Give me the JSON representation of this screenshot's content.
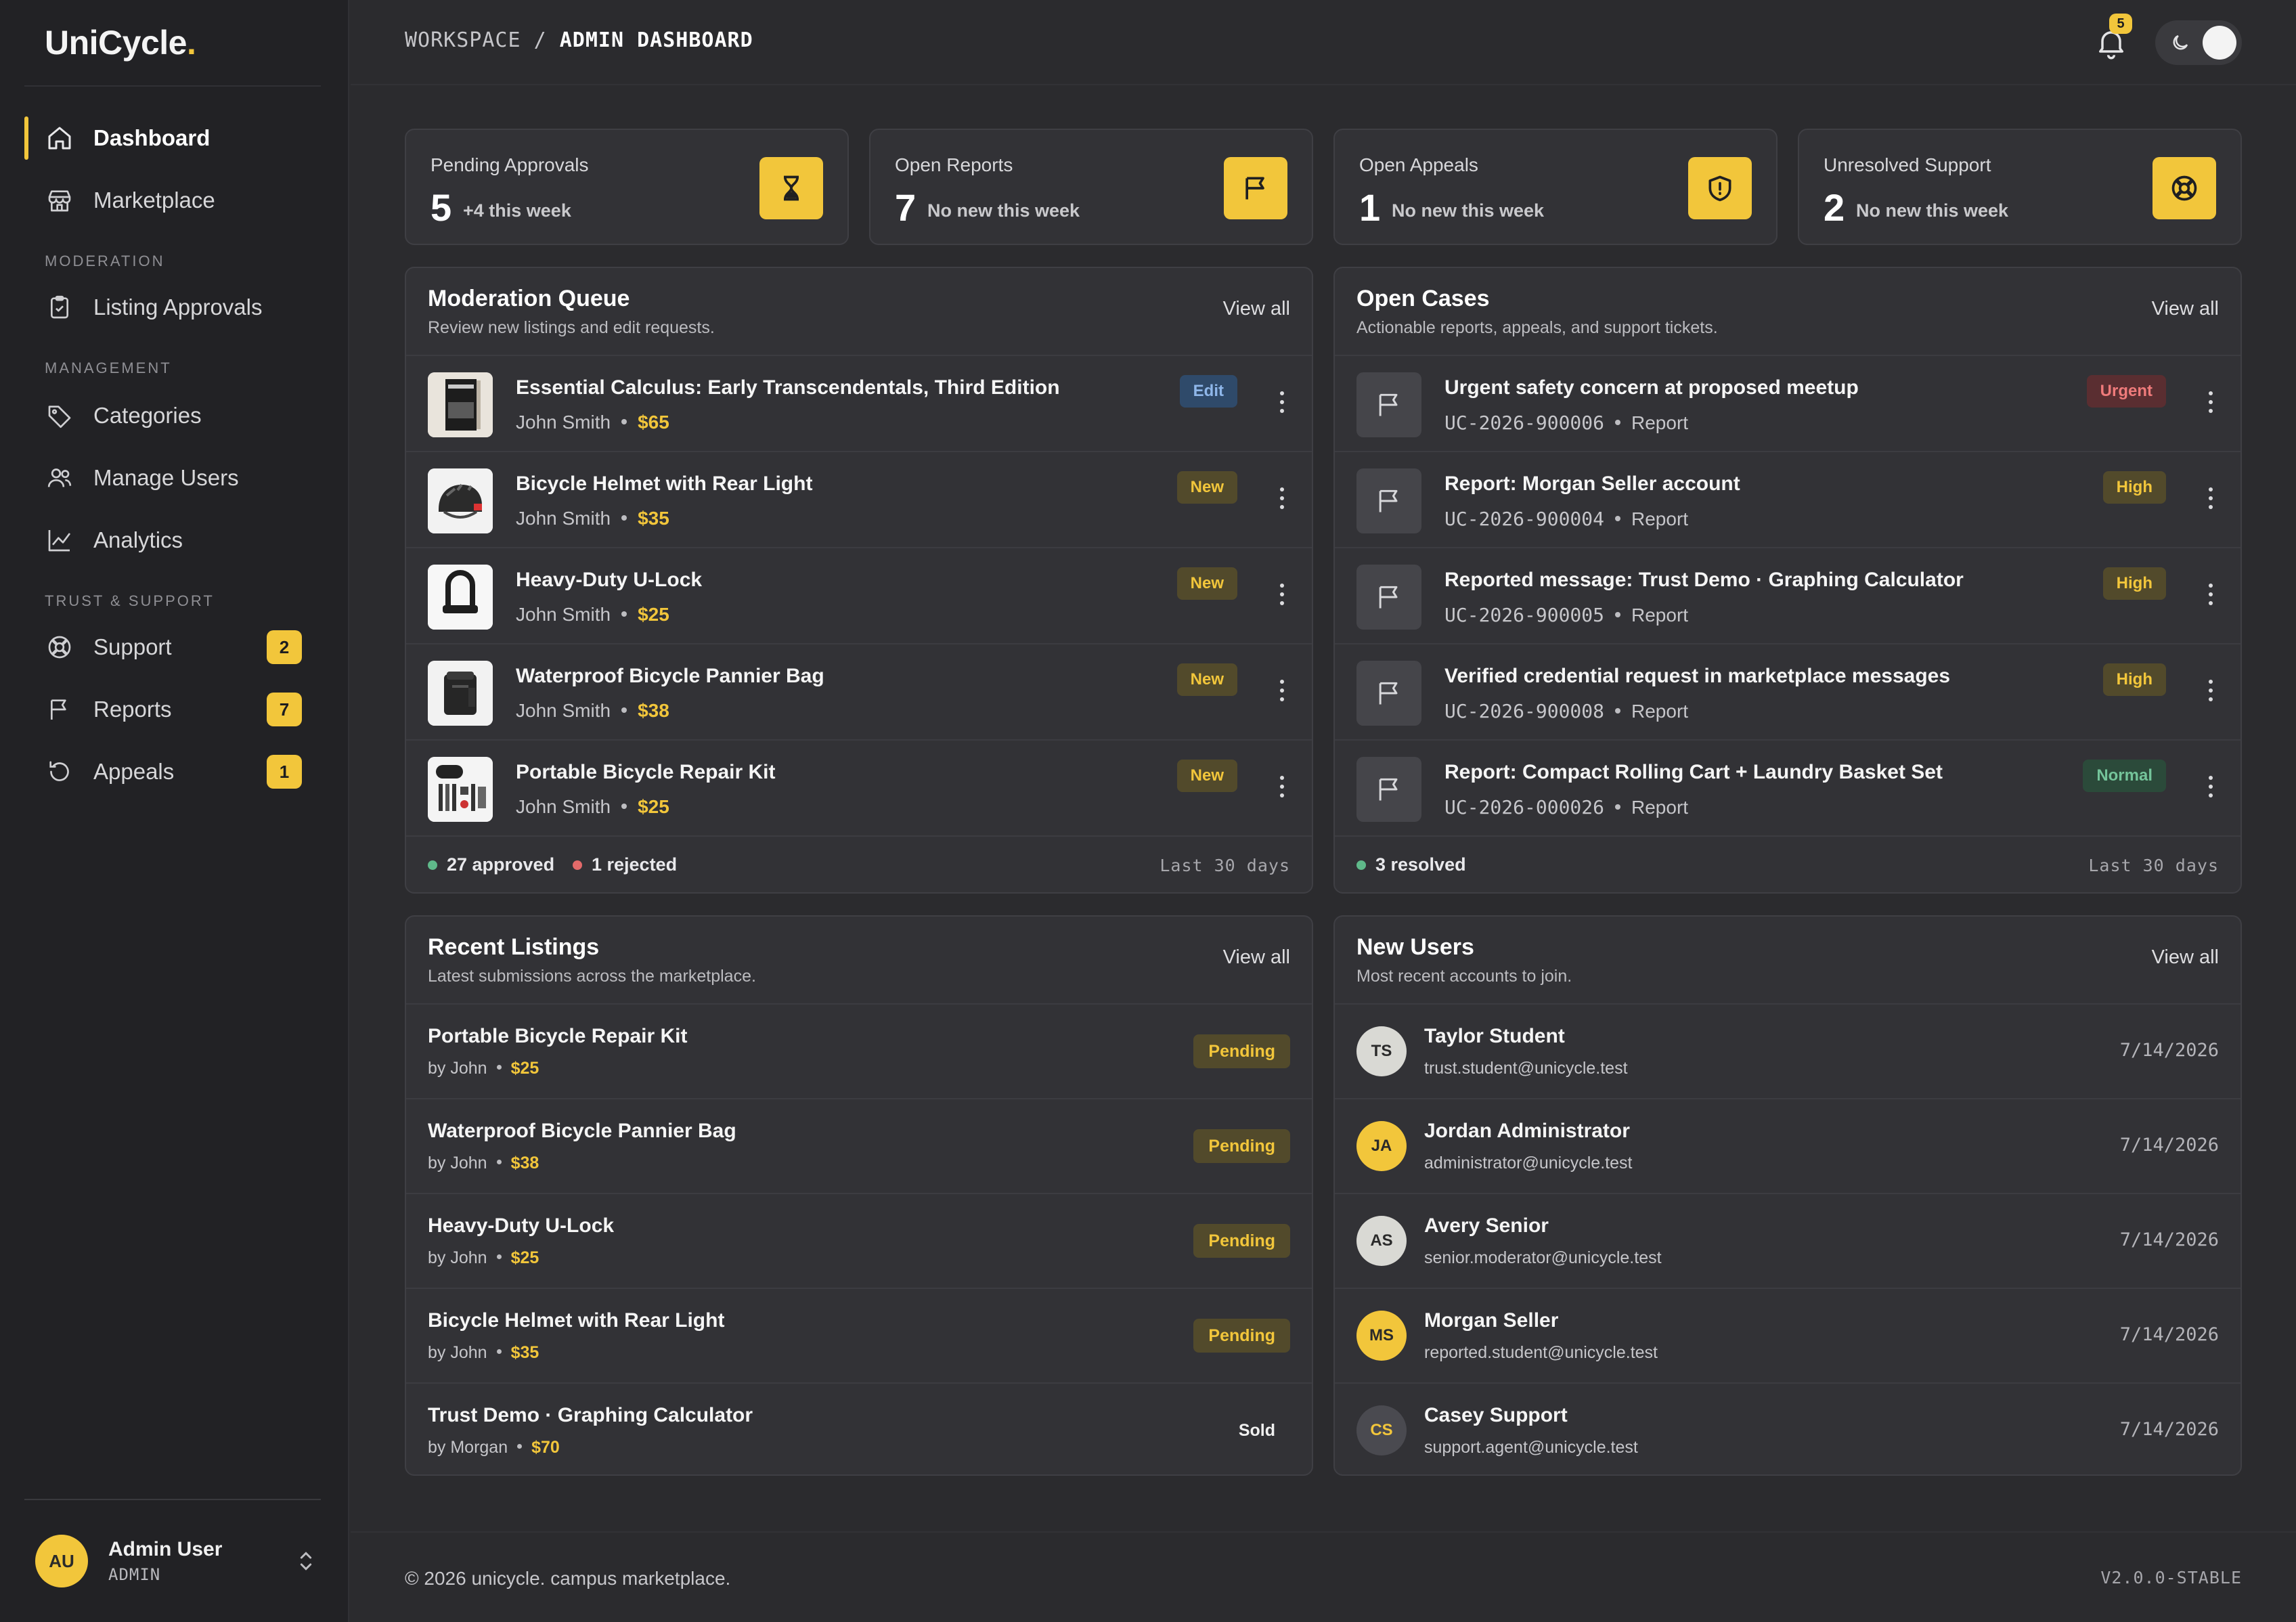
{
  "brand": {
    "name": "UniCycle",
    "dot": "."
  },
  "sidebar": {
    "items": [
      {
        "label": "Dashboard"
      },
      {
        "label": "Marketplace"
      },
      {
        "label": "Listing Approvals"
      },
      {
        "label": "Categories"
      },
      {
        "label": "Manage Users"
      },
      {
        "label": "Analytics"
      },
      {
        "label": "Support",
        "badge": "2"
      },
      {
        "label": "Reports",
        "badge": "7"
      },
      {
        "label": "Appeals",
        "badge": "1"
      }
    ],
    "sections": {
      "moderation": "MODERATION",
      "management": "MANAGEMENT",
      "trust": "TRUST & SUPPORT"
    }
  },
  "user": {
    "initials": "AU",
    "name": "Admin User",
    "role": "ADMIN"
  },
  "topbar": {
    "breadcrumb_root": "WORKSPACE",
    "breadcrumb_sep": "/",
    "breadcrumb_current": "ADMIN DASHBOARD",
    "notification_count": "5"
  },
  "stats": [
    {
      "label": "Pending Approvals",
      "value": "5",
      "sub": "+4 this week"
    },
    {
      "label": "Open Reports",
      "value": "7",
      "sub": "No new this week"
    },
    {
      "label": "Open Appeals",
      "value": "1",
      "sub": "No new this week"
    },
    {
      "label": "Unresolved Support",
      "value": "2",
      "sub": "No new this week"
    }
  ],
  "moderation": {
    "title": "Moderation Queue",
    "subtitle": "Review new listings and edit requests.",
    "view_all": "View all",
    "items": [
      {
        "title": "Essential Calculus: Early Transcendentals, Third Edition",
        "seller": "John Smith",
        "price": "$65",
        "tag": "Edit"
      },
      {
        "title": "Bicycle Helmet with Rear Light",
        "seller": "John Smith",
        "price": "$35",
        "tag": "New"
      },
      {
        "title": "Heavy-Duty U-Lock",
        "seller": "John Smith",
        "price": "$25",
        "tag": "New"
      },
      {
        "title": "Waterproof Bicycle Pannier Bag",
        "seller": "John Smith",
        "price": "$38",
        "tag": "New"
      },
      {
        "title": "Portable Bicycle Repair Kit",
        "seller": "John Smith",
        "price": "$25",
        "tag": "New"
      }
    ],
    "footer": {
      "approved": "27 approved",
      "rejected": "1 rejected",
      "period": "Last 30 days"
    }
  },
  "cases": {
    "title": "Open Cases",
    "subtitle": "Actionable reports, appeals, and support tickets.",
    "view_all": "View all",
    "items": [
      {
        "title": "Urgent safety concern at proposed meetup",
        "id": "UC-2026-900006",
        "kind": "Report",
        "priority": "Urgent"
      },
      {
        "title": "Report: Morgan Seller account",
        "id": "UC-2026-900004",
        "kind": "Report",
        "priority": "High"
      },
      {
        "title": "Reported message: Trust Demo · Graphing Calculator",
        "id": "UC-2026-900005",
        "kind": "Report",
        "priority": "High"
      },
      {
        "title": "Verified credential request in marketplace messages",
        "id": "UC-2026-900008",
        "kind": "Report",
        "priority": "High"
      },
      {
        "title": "Report: Compact Rolling Cart + Laundry Basket Set",
        "id": "UC-2026-000026",
        "kind": "Report",
        "priority": "Normal"
      }
    ],
    "footer": {
      "resolved": "3 resolved",
      "period": "Last 30 days"
    }
  },
  "listings": {
    "title": "Recent Listings",
    "subtitle": "Latest submissions across the marketplace.",
    "view_all": "View all",
    "items": [
      {
        "title": "Portable Bicycle Repair Kit",
        "by": "by John",
        "price": "$25",
        "status": "Pending"
      },
      {
        "title": "Waterproof Bicycle Pannier Bag",
        "by": "by John",
        "price": "$38",
        "status": "Pending"
      },
      {
        "title": "Heavy-Duty U-Lock",
        "by": "by John",
        "price": "$25",
        "status": "Pending"
      },
      {
        "title": "Bicycle Helmet with Rear Light",
        "by": "by John",
        "price": "$35",
        "status": "Pending"
      },
      {
        "title": "Trust Demo · Graphing Calculator",
        "by": "by Morgan",
        "price": "$70",
        "status": "Sold"
      }
    ]
  },
  "new_users": {
    "title": "New Users",
    "subtitle": "Most recent accounts to join.",
    "view_all": "View all",
    "items": [
      {
        "initials": "TS",
        "name": "Taylor Student",
        "email": "trust.student@unicycle.test",
        "date": "7/14/2026",
        "color": "#d9d9d4"
      },
      {
        "initials": "JA",
        "name": "Jordan Administrator",
        "email": "administrator@unicycle.test",
        "date": "7/14/2026",
        "color": "#f2c63b"
      },
      {
        "initials": "AS",
        "name": "Avery Senior",
        "email": "senior.moderator@unicycle.test",
        "date": "7/14/2026",
        "color": "#d9d9d4"
      },
      {
        "initials": "MS",
        "name": "Morgan Seller",
        "email": "reported.student@unicycle.test",
        "date": "7/14/2026",
        "color": "#f2c63b"
      },
      {
        "initials": "CS",
        "name": "Casey Support",
        "email": "support.agent@unicycle.test",
        "date": "7/14/2026",
        "color": "#4a4a50"
      }
    ]
  },
  "footer": {
    "copyright": "© 2026 unicycle. campus marketplace.",
    "version": "V2.0.0-STABLE"
  },
  "colors": {
    "accent": "#f2c63b",
    "bg": "#2b2b2e",
    "panel": "#323236",
    "sidebar": "#222225"
  }
}
